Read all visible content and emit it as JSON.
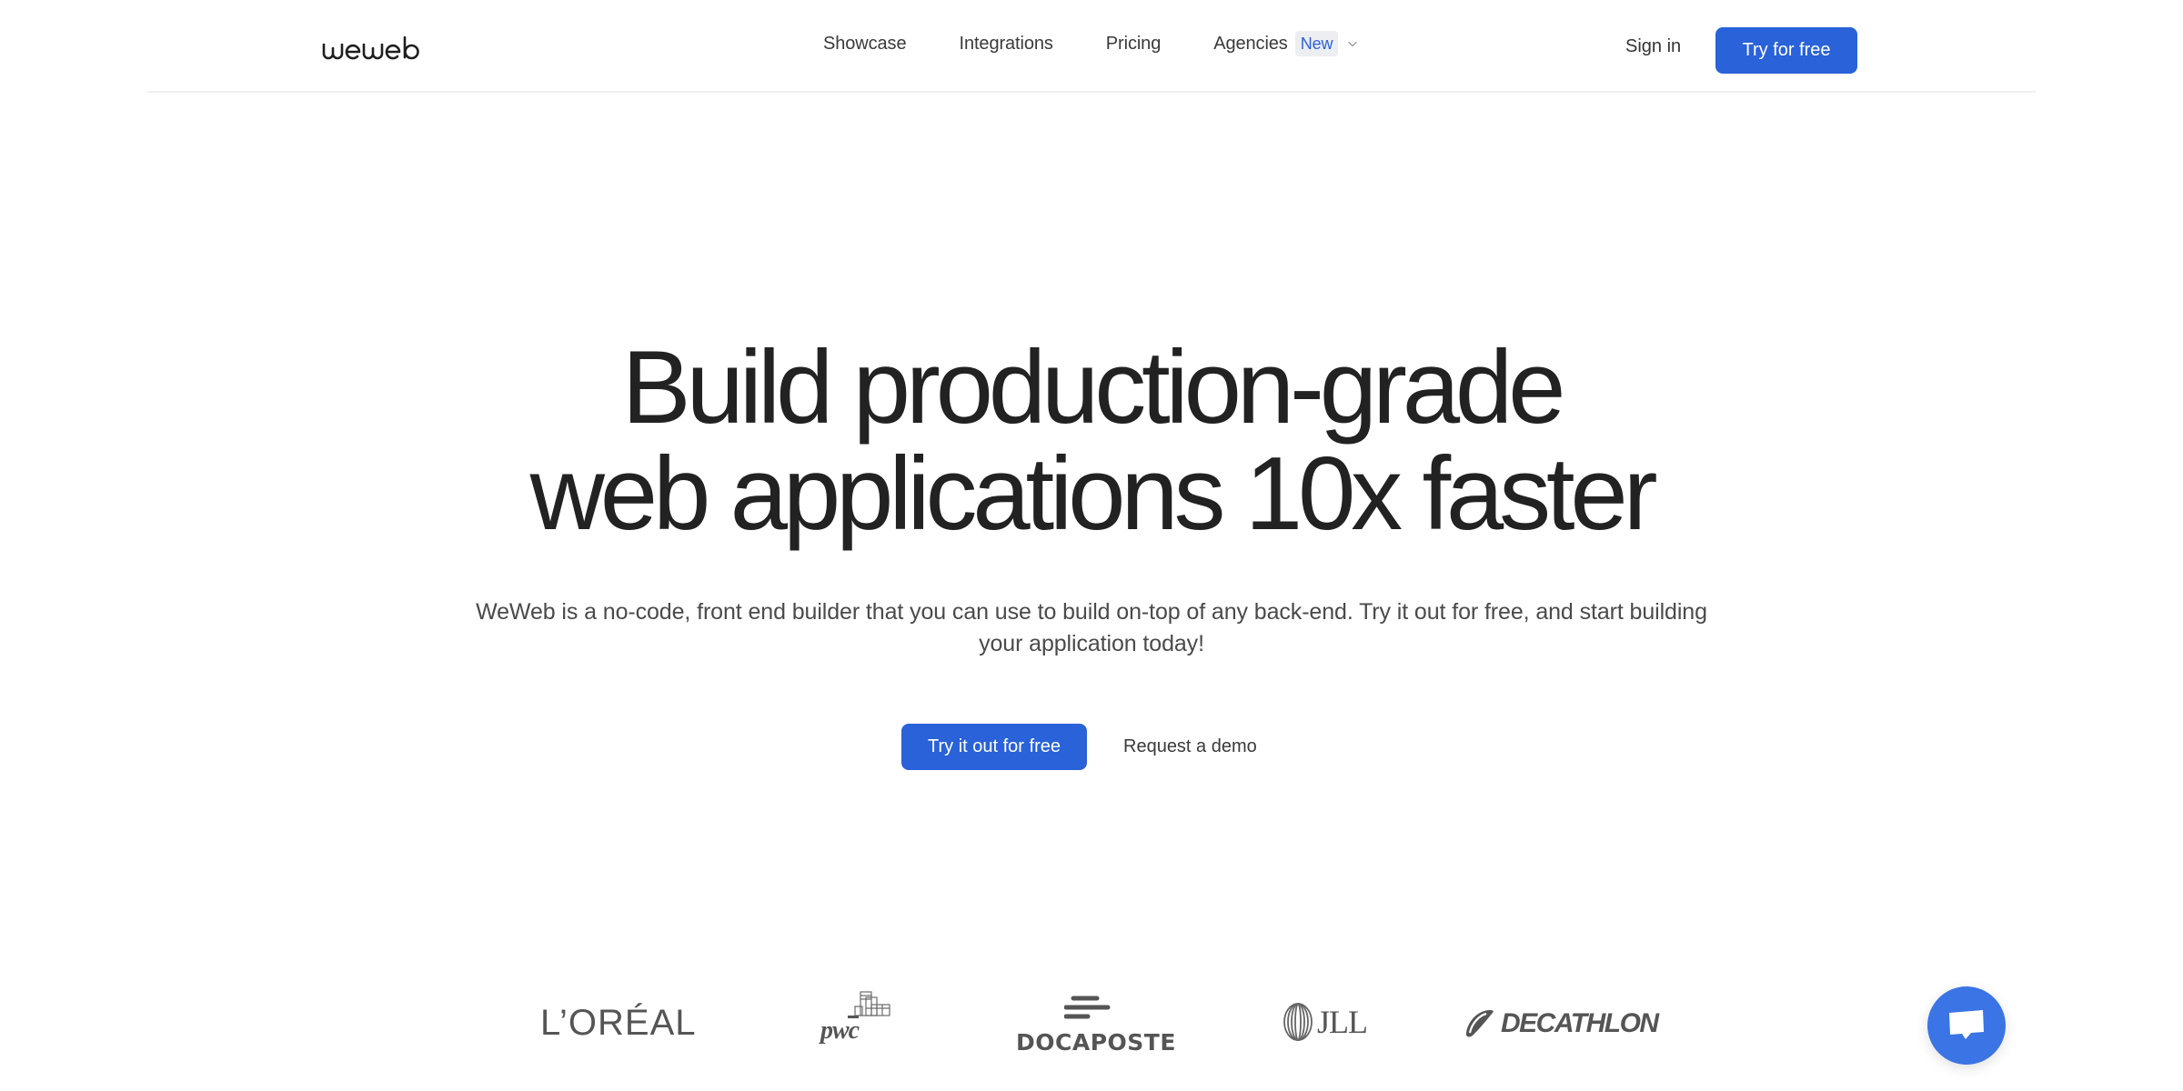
{
  "header": {
    "logo_text": "weweb",
    "nav": [
      {
        "label": "Showcase"
      },
      {
        "label": "Integrations"
      },
      {
        "label": "Pricing"
      },
      {
        "label": "Agencies",
        "badge": "New",
        "has_dropdown": true
      }
    ],
    "sign_in_label": "Sign in",
    "cta_label": "Try for free"
  },
  "hero": {
    "title_line1": "Build production-grade",
    "title_line2": "web applications 10x faster",
    "subtitle": "WeWeb is a no-code, front end builder that you can use to build on-top of any back-end. Try it out for free, and start building your application today!",
    "primary_cta": "Try it out for free",
    "secondary_cta": "Request a demo"
  },
  "logos": [
    {
      "name": "L'ORÉAL",
      "text": "L’ORÉAL"
    },
    {
      "name": "PwC",
      "text": "pwc"
    },
    {
      "name": "Docaposte",
      "text": "DOCAPOSTE"
    },
    {
      "name": "JLL",
      "text": "JLL"
    },
    {
      "name": "Decathlon",
      "text": "DECATHLON"
    }
  ],
  "chat": {
    "icon": "chat-bubble-icon"
  },
  "colors": {
    "primary": "#2962d9",
    "chat": "#3b74e4",
    "badge_text": "#2b63d9",
    "badge_bg": "#eceef2",
    "heading": "#222222",
    "body": "#4a4a4a"
  }
}
